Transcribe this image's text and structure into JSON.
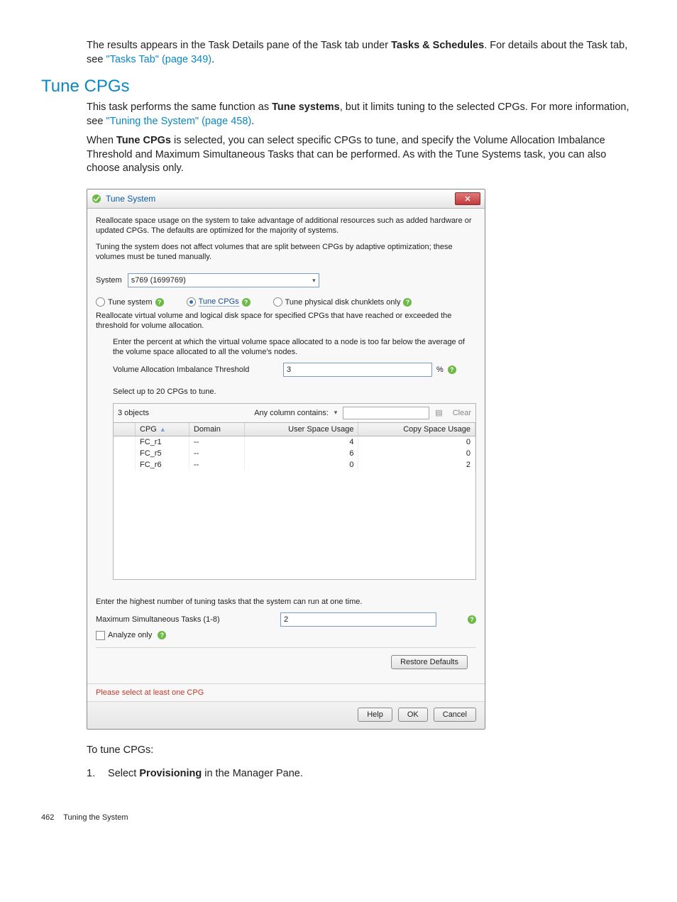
{
  "intro": {
    "p1_a": "The results appears in the Task Details pane of the Task tab under ",
    "p1_b": "Tasks & Schedules",
    "p1_c": ". For details about the Task tab, see ",
    "p1_link": "\"Tasks Tab\" (page 349)",
    "p1_d": "."
  },
  "section_title": "Tune CPGs",
  "body": {
    "p2_a": "This task performs the same function as ",
    "p2_b": "Tune systems",
    "p2_c": ", but it limits tuning to the selected CPGs. For more information, see ",
    "p2_link": "\"Tuning the System\" (page 458)",
    "p2_d": ".",
    "p3_a": "When ",
    "p3_b": "Tune CPGs",
    "p3_c": " is selected, you can select specific CPGs to tune, and specify the Volume Allocation Imbalance Threshold and Maximum Simultaneous Tasks that can be performed. As with the Tune Systems task, you can also choose analysis only."
  },
  "dialog": {
    "title": "Tune System",
    "desc1": "Reallocate space usage on the system to take advantage of additional resources such as added hardware or updated CPGs. The defaults are optimized for the majority of systems.",
    "desc2": "Tuning the system does not affect volumes that are split between CPGs by adaptive optimization; these volumes must be tuned manually.",
    "system_label": "System",
    "system_value": "s769 (1699769)",
    "radio_tune_system": "Tune system",
    "radio_tune_cpgs": "Tune CPGs",
    "radio_physical": "Tune physical disk chunklets only",
    "option_desc": "Reallocate virtual volume and logical disk space for specified CPGs that have reached or exceeded the threshold for volume allocation.",
    "threshold_desc": "Enter the percent at which the virtual volume space allocated to a node is too far below the average of the volume space allocated to all the volume's nodes.",
    "threshold_label": "Volume Allocation Imbalance Threshold",
    "threshold_value": "3",
    "percent_symbol": "%",
    "select_hint": "Select up to 20 CPGs to tune.",
    "objects_count": "3 objects",
    "filter_label": "Any column contains:",
    "clear_label": "Clear",
    "columns": {
      "c1": "CPG",
      "c2": "Domain",
      "c3": "User Space Usage",
      "c4": "Copy Space Usage"
    },
    "rows": [
      {
        "cpg": "FC_r1",
        "domain": "--",
        "user": "4",
        "copy": "0"
      },
      {
        "cpg": "FC_r5",
        "domain": "--",
        "user": "6",
        "copy": "0"
      },
      {
        "cpg": "FC_r6",
        "domain": "--",
        "user": "0",
        "copy": "2"
      }
    ],
    "max_tasks_desc": "Enter the highest number of tuning tasks that the system can run at one time.",
    "max_tasks_label": "Maximum Simultaneous Tasks (1-8)",
    "max_tasks_value": "2",
    "analyze_label": "Analyze only",
    "restore_btn": "Restore Defaults",
    "validation": "Please select at least one CPG",
    "help_btn": "Help",
    "ok_btn": "OK",
    "cancel_btn": "Cancel"
  },
  "after": {
    "to_tune": "To tune CPGs:",
    "step1_a": "Select ",
    "step1_b": "Provisioning",
    "step1_c": " in the Manager Pane."
  },
  "footer": {
    "page_num": "462",
    "section": "Tuning the System"
  },
  "chart_data": {
    "type": "table",
    "columns": [
      "CPG",
      "Domain",
      "User Space Usage",
      "Copy Space Usage"
    ],
    "rows": [
      [
        "FC_r1",
        "--",
        4,
        0
      ],
      [
        "FC_r5",
        "--",
        6,
        0
      ],
      [
        "FC_r6",
        "--",
        0,
        2
      ]
    ]
  }
}
